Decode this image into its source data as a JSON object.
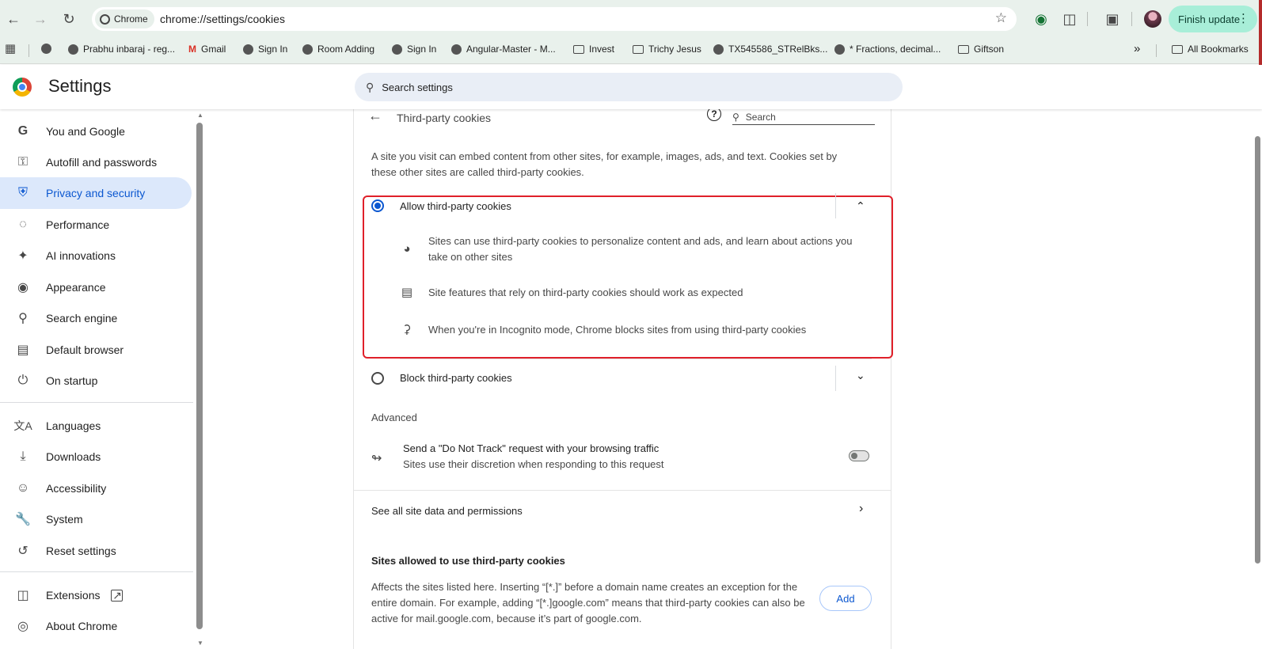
{
  "browser": {
    "chip_label": "Chrome",
    "url": "chrome://settings/cookies",
    "finish_update": "Finish update"
  },
  "bookmarks": [
    {
      "label": "Prabhu inbaraj - reg...",
      "icon": "globe-icon"
    },
    {
      "label": "Gmail",
      "icon": "gmail-icon"
    },
    {
      "label": "Sign In",
      "icon": "globe-icon"
    },
    {
      "label": "Room Adding",
      "icon": "globe-icon"
    },
    {
      "label": "Sign In",
      "icon": "globe-icon"
    },
    {
      "label": "Angular-Master - M...",
      "icon": "globe-icon"
    },
    {
      "label": "Invest",
      "icon": "folder-icon"
    },
    {
      "label": "Trichy Jesus",
      "icon": "folder-icon"
    },
    {
      "label": "TX545586_STRelBks...",
      "icon": "globe-icon"
    },
    {
      "label": "* Fractions, decimal...",
      "icon": "globe-icon"
    },
    {
      "label": "Giftson",
      "icon": "folder-icon"
    }
  ],
  "all_bookmarks": "All Bookmarks",
  "settings": {
    "title": "Settings",
    "search_placeholder": "Search settings"
  },
  "sidebar": {
    "items": [
      {
        "label": "You and Google",
        "icon": "google-icon"
      },
      {
        "label": "Autofill and passwords",
        "icon": "key-icon"
      },
      {
        "label": "Privacy and security",
        "icon": "shield-icon",
        "active": true
      },
      {
        "label": "Performance",
        "icon": "gauge-icon"
      },
      {
        "label": "AI innovations",
        "icon": "sparkle-icon"
      },
      {
        "label": "Appearance",
        "icon": "palette-icon"
      },
      {
        "label": "Search engine",
        "icon": "search-icon"
      },
      {
        "label": "Default browser",
        "icon": "browser-icon"
      },
      {
        "label": "On startup",
        "icon": "power-icon"
      },
      {
        "label": "Languages",
        "icon": "translate-icon"
      },
      {
        "label": "Downloads",
        "icon": "download-icon"
      },
      {
        "label": "Accessibility",
        "icon": "accessibility-icon"
      },
      {
        "label": "System",
        "icon": "wrench-icon"
      },
      {
        "label": "Reset settings",
        "icon": "reset-icon"
      },
      {
        "label": "Extensions",
        "icon": "puzzle-icon"
      },
      {
        "label": "About Chrome",
        "icon": "chrome-icon"
      }
    ]
  },
  "page": {
    "title": "Third-party cookies",
    "search_placeholder": "Search",
    "intro": "A site you visit can embed content from other sites, for example, images, ads, and text. Cookies set by these other sites are called third-party cookies.",
    "allow_label": "Allow third-party cookies",
    "allow_bullets": [
      {
        "icon": "cookie-icon",
        "text": "Sites can use third-party cookies to personalize content and ads, and learn about actions you take on other sites"
      },
      {
        "icon": "web-features-icon",
        "text": "Site features that rely on third-party cookies should work as expected"
      },
      {
        "icon": "incognito-icon",
        "text": "When you're in Incognito mode, Chrome blocks sites from using third-party cookies"
      }
    ],
    "block_label": "Block third-party cookies",
    "advanced": "Advanced",
    "dnt_title": "Send a \"Do Not Track\" request with your browsing traffic",
    "dnt_sub": "Sites use their discretion when responding to this request",
    "see_all": "See all site data and permissions",
    "sites_allowed_title": "Sites allowed to use third-party cookies",
    "sites_allowed_desc": "Affects the sites listed here. Inserting “[*.]” before a domain name creates an exception for the entire domain. For example, adding “[*.]google.com” means that third-party cookies can also be active for mail.google.com, because it’s part of google.com.",
    "add_button": "Add"
  }
}
